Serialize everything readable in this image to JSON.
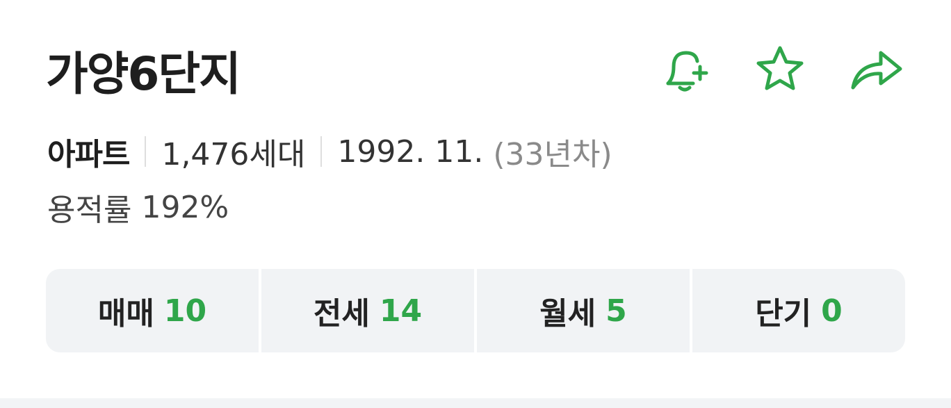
{
  "complex": {
    "name": "가양6단지",
    "type": "아파트",
    "households": "1,476세대",
    "approval_date": "1992. 11.",
    "age": "(33년차)",
    "far_label": "용적률",
    "far_value": "192%"
  },
  "actions": [
    {
      "icon": "bell-plus-icon"
    },
    {
      "icon": "star-icon"
    },
    {
      "icon": "share-arrow-icon"
    }
  ],
  "tabs": [
    {
      "label": "매매",
      "count": "10"
    },
    {
      "label": "전세",
      "count": "14"
    },
    {
      "label": "월세",
      "count": "5"
    },
    {
      "label": "단기",
      "count": "0"
    }
  ],
  "colors": {
    "accent": "#2fa64a",
    "tab_bg": "#f1f3f5",
    "muted_text": "#8a8a8a"
  }
}
